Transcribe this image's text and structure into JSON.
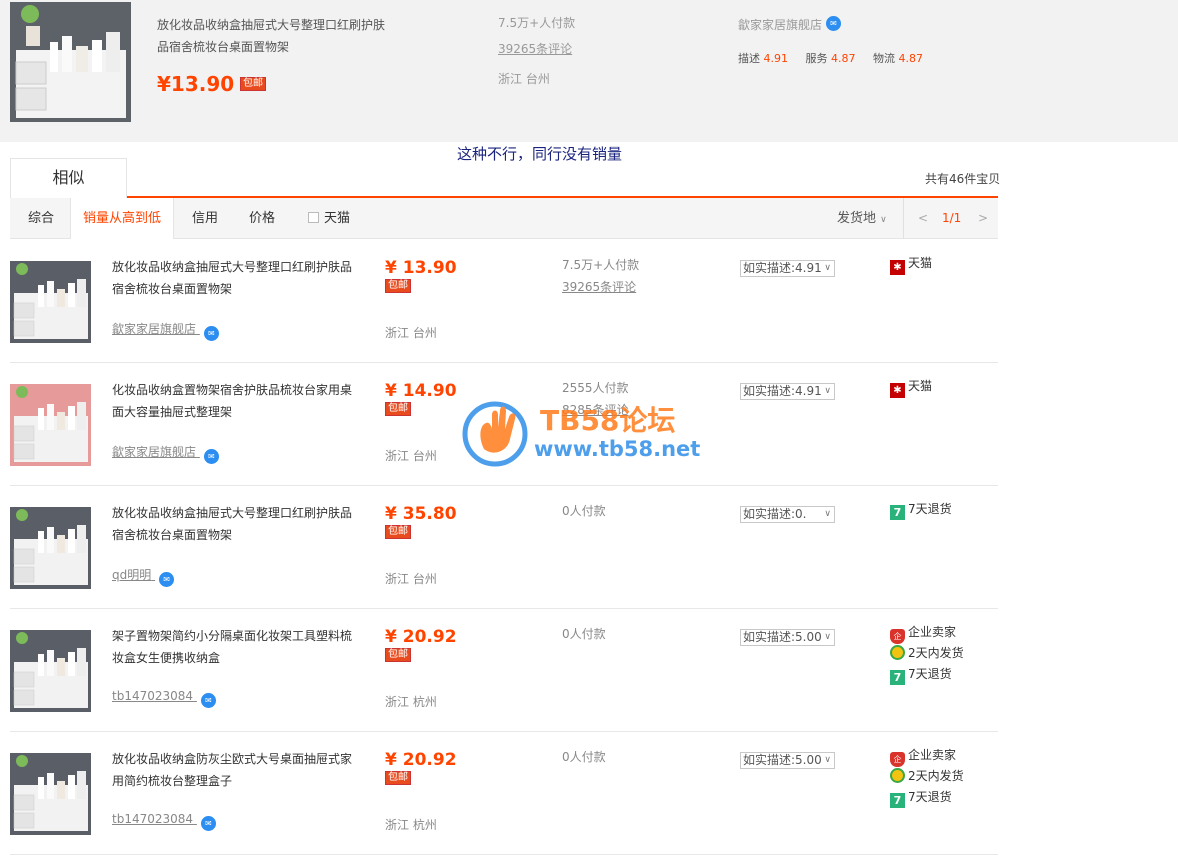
{
  "top_item": {
    "title": "放化妆品收纳盒抽屉式大号整理口红刷护肤品宿舍梳妆台桌面置物架",
    "price": "¥13.90",
    "free_shipping": "包邮",
    "sales": "7.5万+人付款",
    "reviews": "39265条评论",
    "location": "浙江 台州",
    "shop": "歙家家居旗舰店",
    "ratings": [
      {
        "label": "描述",
        "value": "4.91"
      },
      {
        "label": "服务",
        "value": "4.87"
      },
      {
        "label": "物流",
        "value": "4.87"
      }
    ]
  },
  "note": "这种不行，同行没有销量",
  "tab": "相似",
  "total": "共有46件宝贝",
  "sort": {
    "items": [
      "综合",
      "销量从高到低",
      "信用",
      "价格"
    ],
    "tmall_filter": "天猫",
    "destination": "发货地",
    "page": "1/1"
  },
  "rows": [
    {
      "title": "放化妆品收纳盒抽屉式大号整理口红刷护肤品宿舍梳妆台桌面置物架",
      "shop": "歙家家居旗舰店",
      "price": "¥ 13.90",
      "free": "包邮",
      "location": "浙江 台州",
      "sales": "7.5万+人付款",
      "reviews": "39265条评论",
      "desc": "如实描述:4.91",
      "badges": [
        "天猫"
      ],
      "img_color": "#5a5e66"
    },
    {
      "title": "化妆品收纳盒置物架宿舍护肤品梳妆台家用桌面大容量抽屉式整理架",
      "shop": "歙家家居旗舰店",
      "price": "¥ 14.90",
      "free": "包邮",
      "location": "浙江 台州",
      "sales": "2555人付款",
      "reviews": "8285条评论",
      "desc": "如实描述:4.91",
      "badges": [
        "天猫"
      ],
      "img_color": "#e79a9a"
    },
    {
      "title": "放化妆品收纳盒抽屉式大号整理口红刷护肤品宿舍梳妆台桌面置物架",
      "shop": "qd明明",
      "price": "¥ 35.80",
      "free": "包邮",
      "location": "浙江 台州",
      "sales": "0人付款",
      "reviews": "",
      "desc": "如实描述:0.",
      "badges": [
        "7天退货"
      ],
      "img_color": "#5a5e66"
    },
    {
      "title": "架子置物架简约小分隔桌面化妆架工具塑料梳妆盒女生便携收纳盒",
      "shop": "tb147023084",
      "price": "¥ 20.92",
      "free": "包邮",
      "location": "浙江 杭州",
      "sales": "0人付款",
      "reviews": "",
      "desc": "如实描述:5.00",
      "badges": [
        "企业卖家",
        "2天内发货",
        "7天退货"
      ],
      "img_color": "#5a5e66"
    },
    {
      "title": "放化妆品收纳盒防灰尘欧式大号桌面抽屉式家用简约梳妆台整理盒子",
      "shop": "tb147023084",
      "price": "¥ 20.92",
      "free": "包邮",
      "location": "浙江 杭州",
      "sales": "0人付款",
      "reviews": "",
      "desc": "如实描述:5.00",
      "badges": [
        "企业卖家",
        "2天内发货",
        "7天退货"
      ],
      "img_color": "#5a5e66"
    }
  ],
  "watermark": {
    "name": "TB58论坛",
    "url": "www.tb58.net"
  },
  "icons": {
    "tmall": "tmall-icon",
    "return": "seven-day-return-icon",
    "enterprise": "enterprise-seller-icon",
    "ship": "ship-2day-icon"
  }
}
